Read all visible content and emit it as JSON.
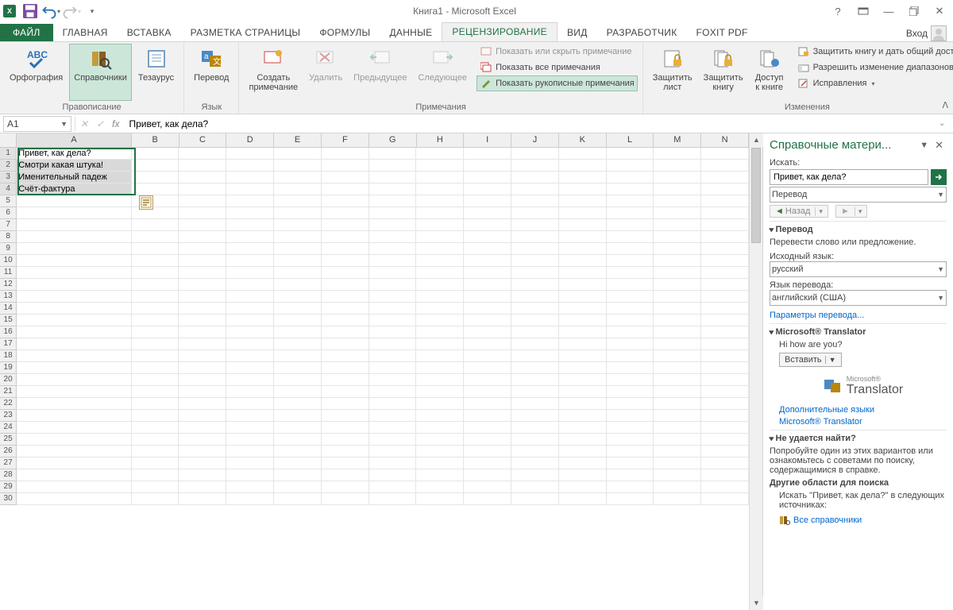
{
  "title": "Книга1 - Microsoft Excel",
  "qat": {
    "excel": "X",
    "save": "save",
    "undo": "undo",
    "redo": "redo"
  },
  "wincontrols": {
    "help": "?",
    "ribbonopts": "▭",
    "min": "—",
    "restore": "❐",
    "close": "✕"
  },
  "login": "Вход",
  "tabs": {
    "file": "ФАЙЛ",
    "items": [
      "ГЛАВНАЯ",
      "ВСТАВКА",
      "РАЗМЕТКА СТРАНИЦЫ",
      "ФОРМУЛЫ",
      "ДАННЫЕ",
      "РЕЦЕНЗИРОВАНИЕ",
      "ВИД",
      "РАЗРАБОТЧИК",
      "FOXIT PDF"
    ],
    "activeIndex": 5
  },
  "ribbon": {
    "groups": {
      "proofing": {
        "label": "Правописание",
        "spell": "Орфография",
        "research": "Справочники",
        "thesaurus": "Тезаурус"
      },
      "language": {
        "label": "Язык",
        "translate": "Перевод"
      },
      "comments": {
        "label": "Примечания",
        "new": "Создать\nпримечание",
        "delete": "Удалить",
        "prev": "Предыдущее",
        "next": "Следующее",
        "showhide": "Показать или скрыть примечание",
        "showall": "Показать все примечания",
        "showink": "Показать рукописные примечания"
      },
      "changes": {
        "label": "Изменения",
        "protectSheet": "Защитить\nлист",
        "protectBook": "Защитить\nкнигу",
        "shareBook": "Доступ\nк книге",
        "protectShare": "Защитить книгу и дать общий доступ",
        "allowRanges": "Разрешить изменение диапазонов",
        "track": "Исправления"
      }
    }
  },
  "namebox": "A1",
  "formula": "Привет, как дела?",
  "columns": [
    "A",
    "B",
    "C",
    "D",
    "E",
    "F",
    "G",
    "H",
    "I",
    "J",
    "K",
    "L",
    "M",
    "N"
  ],
  "cells": {
    "A1": "Привет, как дела?",
    "A2": "Смотри какая штука!",
    "A3": "Именительный падеж",
    "A4": "Счёт-фактура"
  },
  "rowCount": 30,
  "pane": {
    "title": "Справочные матери...",
    "searchLabel": "Искать:",
    "searchValue": "Привет, как дела?",
    "scope": "Перевод",
    "back": "Назад",
    "translateHdr": "Перевод",
    "translateDesc": "Перевести слово или предложение.",
    "srcLabel": "Исходный язык:",
    "srcLang": "русский",
    "dstLabel": "Язык перевода:",
    "dstLang": "английский (США)",
    "options": "Параметры перевода...",
    "msTransHdr": "Microsoft® Translator",
    "result": "Hi how are you?",
    "insert": "Вставить",
    "logo": "Translator",
    "logoSmall": "Microsoft®",
    "moreLangs": "Дополнительные языки",
    "msTransLink": "Microsoft® Translator",
    "cantFindHdr": "Не удается найти?",
    "cantFindBody": "Попробуйте один из этих вариантов или ознакомьтесь с советами по поиску, содержащимися в справке.",
    "otherAreas": "Другие области для поиска",
    "searchIn": "Искать \"Привет, как дела?\" в следующих источниках:",
    "allRef": "Все справочники"
  }
}
